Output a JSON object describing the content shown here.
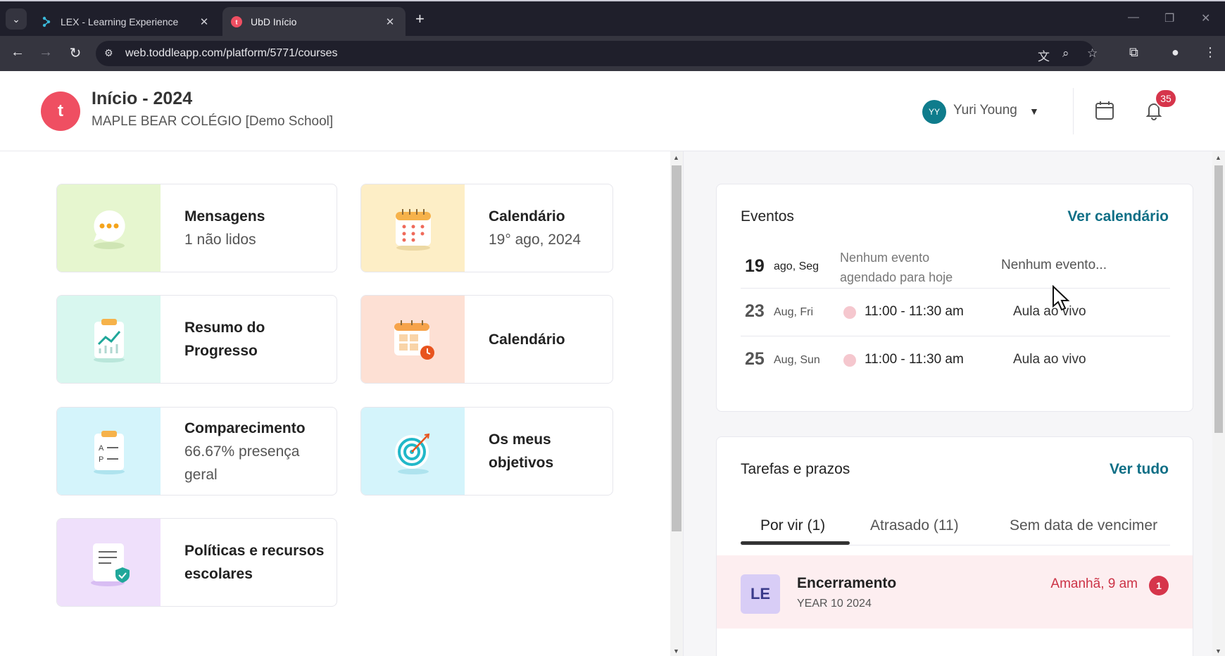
{
  "browser": {
    "tab_list_icon": "chevron-down-icon",
    "tabs": [
      {
        "title": "LEX - Learning Experience",
        "active": false
      },
      {
        "title": "UbD Início",
        "active": true
      }
    ],
    "url": "web.toddleapp.com/platform/5771/courses"
  },
  "header": {
    "logo_letter": "t",
    "title": "Início - 2024",
    "subtitle": "MAPLE BEAR COLÉGIO [Demo School]",
    "user_initials": "YY",
    "user_name": "Yuri Young",
    "notification_count": "35"
  },
  "cards": [
    {
      "title": "Mensagens",
      "detail": "1 não lidos",
      "icon": "chat-bubble-icon",
      "color": "#e6f6cf"
    },
    {
      "title": "Calendário",
      "detail": "19° ago, 2024",
      "icon": "calendar-icon",
      "color": "#fdeec6"
    },
    {
      "title": "Resumo do Progresso",
      "detail": "",
      "icon": "progress-chart-icon",
      "color": "#d8f7ef"
    },
    {
      "title": "Calendário",
      "detail": "",
      "icon": "calendar-clock-icon",
      "color": "#fde0d4"
    },
    {
      "title": "Comparecimento",
      "detail": "66.67% presença geral",
      "icon": "attendance-clipboard-icon",
      "color": "#d4f4fb"
    },
    {
      "title": "Os meus objetivos",
      "detail": "",
      "icon": "target-icon",
      "color": "#d4f4fb"
    },
    {
      "title": "Políticas e recursos escolares",
      "detail": "",
      "icon": "policy-document-icon",
      "color": "#efe0fb"
    }
  ],
  "events": {
    "title": "Eventos",
    "link": "Ver calendário",
    "rows": [
      {
        "day": "19",
        "dow": "ago, Seg",
        "desc": "Nenhum evento agendado para hoje",
        "name": "Nenhum evento..."
      },
      {
        "day": "23",
        "dow": "Aug, Fri",
        "time": "11:00 - 11:30 am",
        "name": "Aula ao vivo"
      },
      {
        "day": "25",
        "dow": "Aug, Sun",
        "time": "11:00 - 11:30 am",
        "name": "Aula ao vivo"
      }
    ]
  },
  "tasks": {
    "title": "Tarefas e prazos",
    "link": "Ver tudo",
    "tabs": [
      "Por vir (1)",
      "Atrasado (11)",
      "Sem data de vencimer"
    ],
    "item": {
      "initials": "LE",
      "title": "Encerramento",
      "subtitle": "YEAR 10 2024",
      "due": "Amanhã, 9 am",
      "count": "1"
    }
  },
  "colors": {
    "brand": "#ef4f62",
    "link": "#0f6f86",
    "alert": "#d6354b"
  }
}
